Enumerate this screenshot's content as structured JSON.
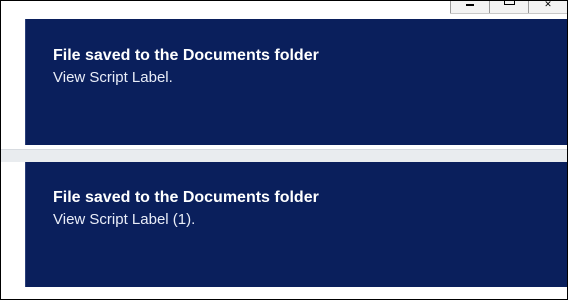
{
  "window": {
    "controls": [
      {
        "name": "minimize",
        "symbol": ""
      },
      {
        "name": "maximize",
        "symbol": ""
      },
      {
        "name": "close",
        "symbol": "✕"
      }
    ]
  },
  "notifications": [
    {
      "title": "File saved to the Documents folder",
      "message": "View Script Label."
    },
    {
      "title": "File saved to the Documents folder",
      "message": "View Script Label (1)."
    }
  ],
  "colors": {
    "toast_background": "#0a1f5c",
    "toast_text": "#ffffff"
  }
}
